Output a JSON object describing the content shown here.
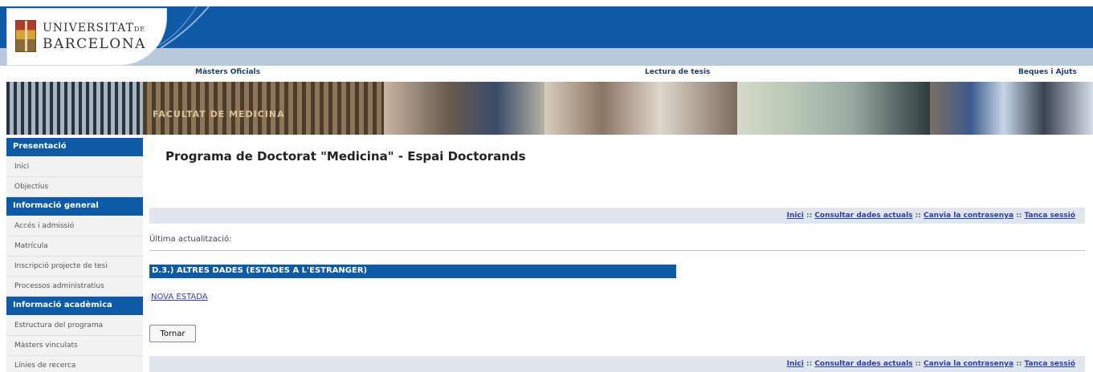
{
  "header": {
    "logo_line1": "UNIVERSITAT",
    "logo_line1_small": "DE",
    "logo_line2": "BARCELONA"
  },
  "topnav": {
    "items": [
      "Màsters Oficials",
      "Lectura de tesis",
      "Beques i Ajuts"
    ]
  },
  "banner": {
    "building_sign": "FACULTAT DE MEDICINA"
  },
  "sidebar": {
    "sections": [
      {
        "title": "Presentació",
        "items": [
          "Inici",
          "Objectius"
        ]
      },
      {
        "title": "Informació general",
        "items": [
          "Accés i admissió",
          "Matrícula",
          "Inscripció projecte de tesi",
          "Processos administratius"
        ]
      },
      {
        "title": "Informació acadèmica",
        "items": [
          "Estructura del programa",
          "Màsters vinculats",
          "Línies de recerca"
        ]
      }
    ]
  },
  "main": {
    "title": "Programa de Doctorat \"Medicina\" - Espai Doctorands",
    "links": [
      "Inici",
      "Consultar dades actuals",
      "Canvia la contrasenya",
      "Tanca sessió"
    ],
    "separator": " :: ",
    "last_update_label": "Última actualització:",
    "section_title": "D.3.) ALTRES DADES (ESTADES A L'ESTRANGER)",
    "new_stay_link": "NOVA ESTADA",
    "back_button": "Tornar"
  },
  "colors": {
    "brand_blue": "#0e5aa7",
    "link_bar_bg": "#dfe6ef",
    "link_color": "#2c3ea0"
  }
}
